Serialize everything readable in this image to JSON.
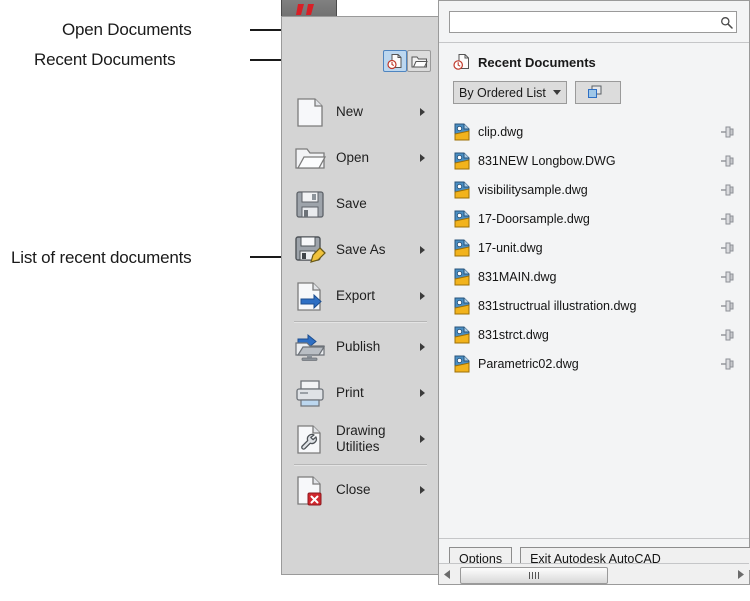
{
  "annotations": [
    {
      "id": "open-documents",
      "label": "Open Documents"
    },
    {
      "id": "recent-documents",
      "label": "Recent Documents"
    },
    {
      "id": "list-of-recent-documents",
      "label": "List of recent documents"
    }
  ],
  "app_button": {
    "name": "application-menu-button",
    "logo": "autocad-a-logo"
  },
  "toggles": [
    {
      "name": "recent-documents-toggle",
      "icon": "document-clock-icon",
      "active": true
    },
    {
      "name": "open-documents-toggle",
      "icon": "open-folder-icon",
      "active": false
    }
  ],
  "menu": {
    "items": [
      {
        "label": "New",
        "icon": "new-document-icon",
        "arrow": true,
        "separator_after": false
      },
      {
        "label": "Open",
        "icon": "open-folder-icon",
        "arrow": true,
        "separator_after": false
      },
      {
        "label": "Save",
        "icon": "floppy-disk-icon",
        "arrow": false,
        "separator_after": false
      },
      {
        "label": "Save As",
        "icon": "floppy-pencil-icon",
        "arrow": true,
        "separator_after": false
      },
      {
        "label": "Export",
        "icon": "document-arrow-icon",
        "arrow": true,
        "separator_after": true
      },
      {
        "label": "Publish",
        "icon": "publish-folder-icon",
        "arrow": true,
        "separator_after": false
      },
      {
        "label": "Print",
        "icon": "printer-icon",
        "arrow": true,
        "separator_after": false
      },
      {
        "label": "Drawing\nUtilities",
        "icon": "document-wrench-icon",
        "arrow": true,
        "separator_after": true
      },
      {
        "label": "Close",
        "icon": "document-close-icon",
        "arrow": true,
        "separator_after": false
      }
    ]
  },
  "search": {
    "value": "",
    "placeholder": "",
    "icon": "search-icon"
  },
  "recent_panel": {
    "header": "Recent Documents",
    "header_icon": "document-clock-icon",
    "sort_dropdown": {
      "value": "By Ordered List",
      "icon": "chevron-down-icon"
    },
    "view_dropdown": {
      "icon": "icon-size-icon",
      "caret": "chevron-down-icon"
    },
    "documents": [
      {
        "name": "clip.dwg",
        "icon": "dwg-file-icon",
        "pin": "pin-icon"
      },
      {
        "name": "831NEW Longbow.DWG",
        "icon": "dwg-file-icon",
        "pin": "pin-icon"
      },
      {
        "name": "visibilitysample.dwg",
        "icon": "dwg-file-icon",
        "pin": "pin-icon"
      },
      {
        "name": "17-Doorsample.dwg",
        "icon": "dwg-file-icon",
        "pin": "pin-icon"
      },
      {
        "name": "17-unit.dwg",
        "icon": "dwg-file-icon",
        "pin": "pin-icon"
      },
      {
        "name": "831MAIN.dwg",
        "icon": "dwg-file-icon",
        "pin": "pin-icon"
      },
      {
        "name": "831structrual illustration.dwg",
        "icon": "dwg-file-icon",
        "pin": "pin-icon"
      },
      {
        "name": "831strct.dwg",
        "icon": "dwg-file-icon",
        "pin": "pin-icon"
      },
      {
        "name": "Parametric02.dwg",
        "icon": "dwg-file-icon",
        "pin": "pin-icon"
      }
    ]
  },
  "footer": {
    "options_label": "Options",
    "exit_label": "Exit Autodesk AutoCAD"
  },
  "scrollbar": {
    "left_arrow": "triangle-left-icon",
    "right_arrow": "triangle-right-icon"
  },
  "colors": {
    "menu_bg": "#d4d4d4",
    "panel_bg": "#f3f4f5",
    "border": "#9a9a9a",
    "accent_active": "#bcd7ef",
    "accent_border": "#4f85c0",
    "text": "#1a1a1a",
    "logo_red": "#d81f26"
  }
}
